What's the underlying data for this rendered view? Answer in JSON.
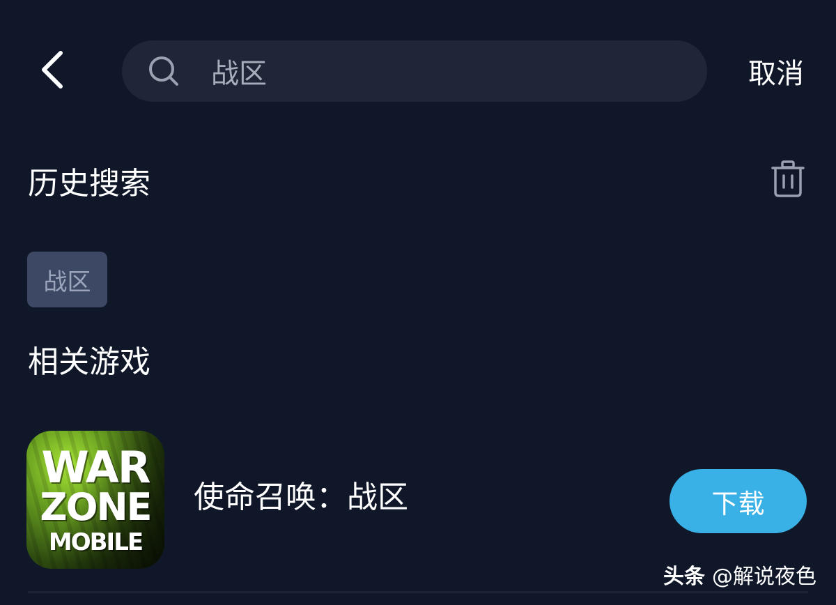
{
  "header": {
    "back_icon": "chevron-left-icon",
    "search": {
      "icon": "search-icon",
      "value": "战区"
    },
    "cancel_label": "取消"
  },
  "history": {
    "title": "历史搜索",
    "clear_icon": "trash-icon",
    "items": [
      "战区"
    ]
  },
  "related_games": {
    "title": "相关游戏",
    "items": [
      {
        "name": "使命召唤：战区",
        "icon_logo_lines": [
          "WAR",
          "ZONE",
          "MOBILE"
        ],
        "action_label": "下载"
      }
    ]
  },
  "watermark": {
    "brand": "头条",
    "handle": "@解说夜色"
  },
  "colors": {
    "background": "#0f1729",
    "search_box": "#1e2638",
    "chip": "#3d4964",
    "download_button": "#39b1e6",
    "icon_green": "#a7e436"
  }
}
